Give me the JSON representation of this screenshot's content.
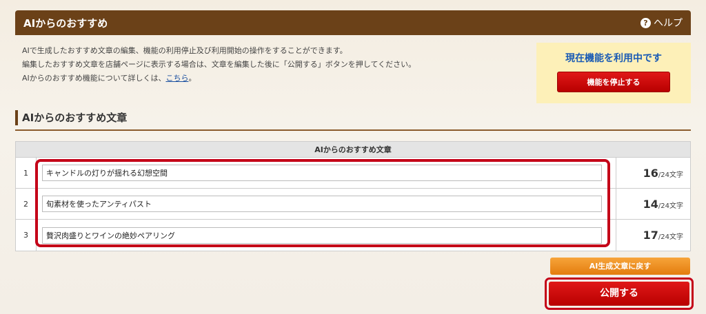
{
  "header": {
    "title": "AIからのおすすめ",
    "help_label": "ヘルプ",
    "help_icon": "question-circle-icon"
  },
  "description": {
    "line1": "AIで生成したおすすめ文章の編集、機能の利用停止及び利用開始の操作をすることができます。",
    "line2": "編集したおすすめ文章を店舗ページに表示する場合は、文章を編集した後に「公開する」ボタンを押してください。",
    "line3_prefix": "AIからのおすすめ機能について詳しくは、",
    "line3_link": "こちら",
    "line3_suffix": "。"
  },
  "status": {
    "text": "現在機能を利用中です",
    "stop_button": "機能を停止する"
  },
  "section": {
    "title": "AIからのおすすめ文章"
  },
  "table": {
    "header": "AIからのおすすめ文章",
    "rows": [
      {
        "num": "1",
        "text": "キャンドルの灯りが揺れる幻想空間",
        "count": "16",
        "max": "/24文字"
      },
      {
        "num": "2",
        "text": "旬素材を使ったアンティパスト",
        "count": "14",
        "max": "/24文字"
      },
      {
        "num": "3",
        "text": "贅沢肉盛りとワインの絶妙ペアリング",
        "count": "17",
        "max": "/24文字"
      }
    ]
  },
  "actions": {
    "back_button": "AI生成文章に戻す",
    "publish_button": "公開する"
  },
  "colors": {
    "header_bg": "#6b4118",
    "accent_red": "#c40018",
    "link": "#1a4fa0",
    "status_bg": "#fdf0b8"
  }
}
